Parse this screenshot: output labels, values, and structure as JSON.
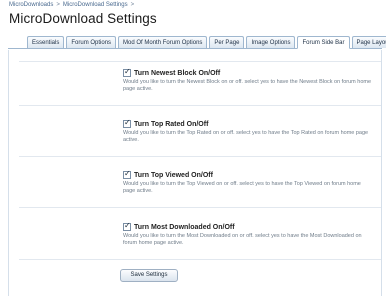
{
  "breadcrumb": {
    "items": [
      "MicroDownloads",
      "MicroDownload Settings"
    ],
    "separator": ">"
  },
  "page_title": "MicroDownload Settings",
  "tabs": [
    {
      "label": "Essentials",
      "active": false
    },
    {
      "label": "Forum Options",
      "active": false
    },
    {
      "label": "Mod Of Month Forum Options",
      "active": false
    },
    {
      "label": "Per Page",
      "active": false
    },
    {
      "label": "Image Options",
      "active": false
    },
    {
      "label": "Forum Side Bar",
      "active": true
    },
    {
      "label": "Page Layout",
      "active": false
    }
  ],
  "options": [
    {
      "label": "Turn Newest Block On/Off",
      "checked": true,
      "description": "Would you like to turn the Newest Block on or off. select yes to have the Newest Block on forum home page active."
    },
    {
      "label": "Turn Top Rated On/Off",
      "checked": true,
      "description": "Would you like to turn the Top Rated on or off. select yes to have the Top Rated on forum home page active."
    },
    {
      "label": "Turn Top Viewed On/Off",
      "checked": true,
      "description": "Would you like to turn the Top Viewed on or off. select yes to have the Top Viewed on forum home page active."
    },
    {
      "label": "Turn Most Downloaded On/Off",
      "checked": true,
      "description": "Would you like to turn the Most Downloaded on or off. select yes to have the Most Downloaded on forum home page active."
    }
  ],
  "save_button": {
    "label": "Save Settings"
  },
  "colors": {
    "link": "#4a6a8f",
    "tab_border": "#9fb7cf",
    "description": "#6f7c89"
  }
}
